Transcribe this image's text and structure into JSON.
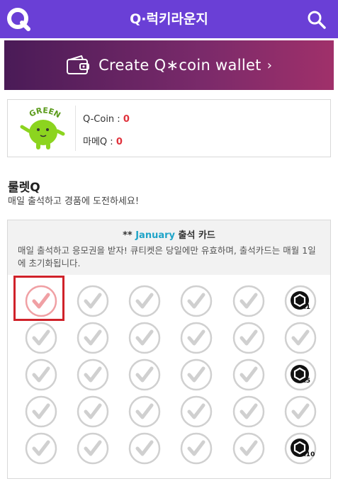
{
  "header": {
    "title": "Q·럭키라운지"
  },
  "banner": {
    "text": "Create Q∗coin wallet",
    "chevron": "›"
  },
  "profile": {
    "badge_text": "GREEN",
    "qcoin_label": "Q-Coin : ",
    "qcoin_value": "0",
    "mameq_label": "마메Q : ",
    "mameq_value": "0"
  },
  "section": {
    "title": "룰렛Q",
    "subtitle": "매일 출석하고 경품에 도전하세요!"
  },
  "attendance": {
    "title_prefix": "** ",
    "month": "January",
    "title_suffix": " 출석 카드",
    "description": "매일 출석하고 응모권을 받자! 큐티켓은 당일에만 유효하며, 출석카드는 매월 1일에 초기화됩니다.",
    "rows": [
      [
        "check-today",
        "check",
        "check",
        "check",
        "check",
        "reward-x1"
      ],
      [
        "check",
        "check",
        "check",
        "check",
        "check",
        "check"
      ],
      [
        "check",
        "check",
        "check",
        "check",
        "check",
        "reward-x5"
      ],
      [
        "check",
        "check",
        "check",
        "check",
        "check",
        "check"
      ],
      [
        "check",
        "check",
        "check",
        "check",
        "check",
        "reward-x10"
      ]
    ],
    "reward_labels": {
      "reward-x1": "x1",
      "reward-x5": "x5",
      "reward-x10": "x10"
    }
  },
  "colors": {
    "header": "#6a3fd6",
    "accent_red": "#e0323c",
    "month": "#1fa4c8",
    "check_grey": "#d0d0d0",
    "check_today": "#f0a0a4"
  }
}
